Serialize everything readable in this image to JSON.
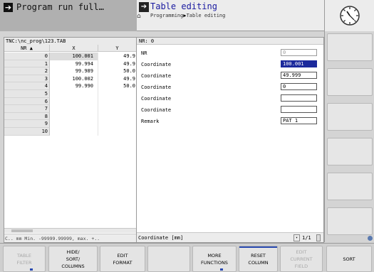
{
  "header": {
    "left_mode": "Program run full…",
    "right_title": "Table editing",
    "breadcrumb": [
      "Programming",
      "Table editing"
    ]
  },
  "table": {
    "path": "TNC:\\nc_prog\\123.TAB",
    "columns": [
      "NR",
      "X",
      "Y"
    ],
    "rows": [
      {
        "nr": "0",
        "x": "100.001",
        "y": "49.9"
      },
      {
        "nr": "1",
        "x": "99.994",
        "y": "49.9"
      },
      {
        "nr": "2",
        "x": "99.989",
        "y": "50.0"
      },
      {
        "nr": "3",
        "x": "100.002",
        "y": "49.9"
      },
      {
        "nr": "4",
        "x": "99.990",
        "y": "50.0"
      },
      {
        "nr": "5",
        "x": "",
        "y": ""
      },
      {
        "nr": "6",
        "x": "",
        "y": ""
      },
      {
        "nr": "7",
        "x": "",
        "y": ""
      },
      {
        "nr": "8",
        "x": "",
        "y": ""
      },
      {
        "nr": "9",
        "x": "",
        "y": ""
      },
      {
        "nr": "10",
        "x": "",
        "y": ""
      }
    ],
    "status": "C.. mm Min. -99999.99999, max. +.."
  },
  "form": {
    "title": "NR: 0",
    "fields": [
      {
        "label": "NR",
        "value": "0"
      },
      {
        "label": "Coordinate",
        "value": "100.001"
      },
      {
        "label": "Coordinate",
        "value": "49.999"
      },
      {
        "label": "Coordinate",
        "value": "0"
      },
      {
        "label": "Coordinate",
        "value": ""
      },
      {
        "label": "Coordinate",
        "value": ""
      },
      {
        "label": "Remark",
        "value": "PAT 1"
      }
    ],
    "field_info": "Coordinate [mm]",
    "page": "1/1"
  },
  "softkeys": [
    {
      "label": "TABLE\nFILTER",
      "enabled": false
    },
    {
      "label": "HIDE/\nSORT/\nCOLUMNS",
      "enabled": true
    },
    {
      "label": "EDIT\nFORMAT",
      "enabled": true
    },
    {
      "label": "",
      "enabled": true
    },
    {
      "label": "MORE\nFUNCTIONS",
      "enabled": true
    },
    {
      "label": "RESET\nCOLUMN",
      "enabled": true
    },
    {
      "label": "EDIT\nCURRENT\nFIELD",
      "enabled": false
    },
    {
      "label": "SORT",
      "enabled": true
    }
  ],
  "colors": {
    "accent": "#1c2a9c",
    "title_text": "#1a1aa0"
  }
}
